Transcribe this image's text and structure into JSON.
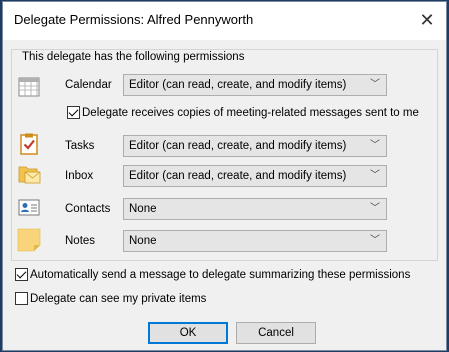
{
  "dialog": {
    "title": "Delegate Permissions: Alfred Pennyworth",
    "close_glyph": "✕"
  },
  "permissions": {
    "legend": "This delegate has the following permissions",
    "rows": [
      {
        "label": "Calendar",
        "value": "Editor (can read, create, and modify items)",
        "icon": "calendar-icon"
      },
      {
        "label": "Tasks",
        "value": "Editor (can read, create, and modify items)",
        "icon": "tasks-icon"
      },
      {
        "label": "Inbox",
        "value": "Editor (can read, create, and modify items)",
        "icon": "inbox-icon"
      },
      {
        "label": "Contacts",
        "value": "None",
        "icon": "contacts-icon"
      },
      {
        "label": "Notes",
        "value": "None",
        "icon": "notes-icon"
      }
    ],
    "meeting_copies": {
      "label": "Delegate receives copies of meeting-related messages sent to me",
      "checked": true
    }
  },
  "options": {
    "auto_send": {
      "label": "Automatically send a message to delegate summarizing these permissions",
      "checked": true
    },
    "private_items": {
      "label": "Delegate can see my private items",
      "checked": false
    }
  },
  "buttons": {
    "ok": "OK",
    "cancel": "Cancel"
  },
  "colors": {
    "accent": "#0078d7"
  }
}
